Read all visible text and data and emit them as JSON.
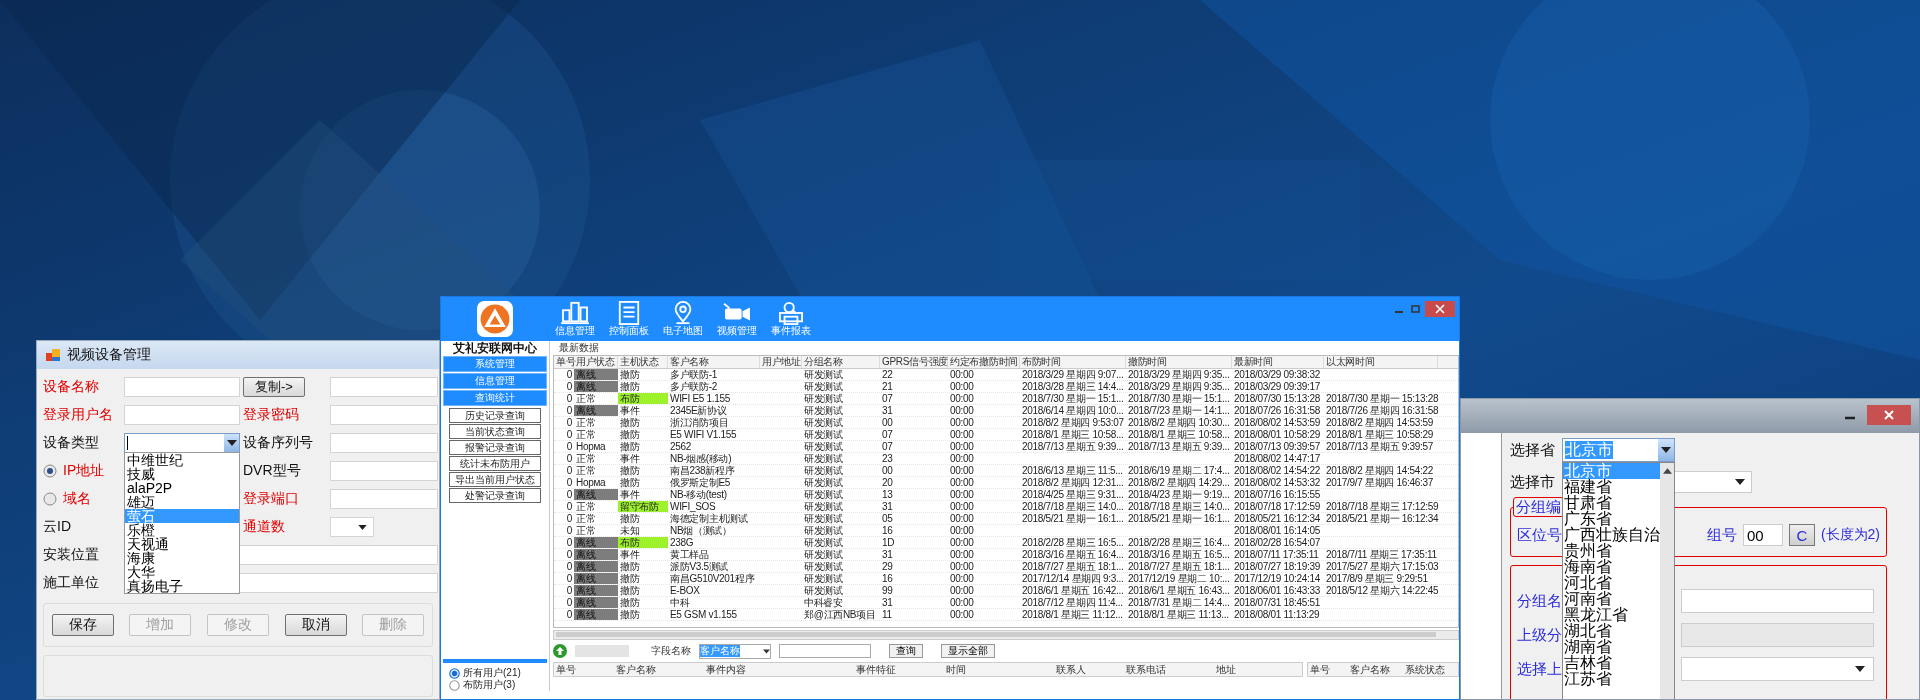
{
  "device_window": {
    "title": "视频设备管理",
    "rows": [
      {
        "left": {
          "kind": "label",
          "text": "设备名称",
          "required": true,
          "control": {
            "kind": "input"
          }
        },
        "right": {
          "kind": "button",
          "text": "复制->",
          "control": {
            "kind": "input"
          }
        }
      },
      {
        "left": {
          "kind": "label",
          "text": "登录用户名",
          "required": true,
          "control": {
            "kind": "input"
          }
        },
        "right": {
          "kind": "label",
          "text": "登录密码",
          "required": true,
          "control": {
            "kind": "input"
          }
        }
      },
      {
        "left": {
          "kind": "label",
          "text": "设备类型",
          "required": false,
          "control": {
            "kind": "combo"
          }
        },
        "right": {
          "kind": "label",
          "text": "设备序列号",
          "required": false,
          "control": {
            "kind": "input"
          }
        }
      },
      {
        "left": {
          "kind": "radio",
          "text": "IP地址",
          "required": true,
          "selected": true
        },
        "right": {
          "kind": "label",
          "text": "DVR型号",
          "required": false,
          "control": {
            "kind": "input"
          }
        }
      },
      {
        "left": {
          "kind": "radio",
          "text": "域名",
          "required": true,
          "selected": false
        },
        "right": {
          "kind": "label",
          "text": "登录端口",
          "required": true,
          "control": {
            "kind": "input"
          }
        }
      },
      {
        "left": {
          "kind": "label",
          "text": "云ID",
          "required": false
        },
        "right": {
          "kind": "label",
          "text": "通道数",
          "required": true,
          "control": {
            "kind": "select"
          }
        }
      },
      {
        "left": {
          "kind": "label",
          "text": "安装位置",
          "required": false,
          "control": {
            "kind": "wide"
          }
        }
      },
      {
        "left": {
          "kind": "label",
          "text": "施工单位",
          "required": false,
          "control": {
            "kind": "wide"
          }
        }
      }
    ],
    "device_types": [
      {
        "text": "中维世纪",
        "selected": false
      },
      {
        "text": "技威",
        "selected": false
      },
      {
        "text": "alaP2P",
        "selected": false
      },
      {
        "text": "雄迈",
        "selected": false
      },
      {
        "text": "萤石",
        "selected": true
      },
      {
        "text": "乐橙",
        "selected": false
      },
      {
        "text": "天视通",
        "selected": false
      },
      {
        "text": "海康",
        "selected": false
      },
      {
        "text": "大华",
        "selected": false
      },
      {
        "text": "真扬电子",
        "selected": false
      }
    ],
    "buttons": [
      {
        "text": "保存",
        "disabled": false
      },
      {
        "text": "增加",
        "disabled": true
      },
      {
        "text": "修改",
        "disabled": true
      },
      {
        "text": "取消",
        "disabled": false
      },
      {
        "text": "删除",
        "disabled": true
      }
    ]
  },
  "monitor_window": {
    "brand": "艾礼安联网中心",
    "toolbar": [
      {
        "label": "信息管理",
        "kind": "buildings"
      },
      {
        "label": "控制面板",
        "kind": "list"
      },
      {
        "label": "电子地图",
        "kind": "pin"
      },
      {
        "label": "视频管理",
        "kind": "camera"
      },
      {
        "label": "事件报表",
        "kind": "printer"
      }
    ],
    "menu": [
      "系统管理",
      "信息管理",
      "查询统计"
    ],
    "submenu": [
      "历史记录查询",
      "当前状态查询",
      "报警记录查询",
      "统计未布防用户",
      "导出当前用户状态",
      "处警记录查询"
    ],
    "tab": "最新数据",
    "columns": [
      "单号",
      "用户状态",
      "主机状态",
      "客户名称",
      "用户地址",
      "分组名称",
      "GPRS信号强度",
      "约定布撤防时间",
      "布防时间",
      "撤防时间",
      "最新时间",
      "以太网时间"
    ],
    "rows": [
      {
        "no": "0",
        "user_state": "离线",
        "offline": true,
        "host_state": "撤防",
        "armed": false,
        "customer": "多户联防-1",
        "group": "研发测试",
        "gprs": "22",
        "schedule": "00:00",
        "arm_time": "2018/3/29 星期四 9:07...",
        "disarm_time": "2018/3/29 星期四 9:35...",
        "latest": "2018/03/29 09:38:32"
      },
      {
        "no": "0",
        "user_state": "离线",
        "offline": true,
        "host_state": "撤防",
        "armed": false,
        "customer": "多户联防-2",
        "group": "研发测试",
        "gprs": "21",
        "schedule": "00:00",
        "arm_time": "2018/3/28 星期三 14:4...",
        "disarm_time": "2018/3/29 星期四 9:35...",
        "latest": "2018/03/29 09:39:17"
      },
      {
        "no": "0",
        "user_state": "正常",
        "offline": false,
        "host_state": "布防",
        "armed": true,
        "customer": "WIFI E5 1.155",
        "group": "研发测试",
        "gprs": "07",
        "schedule": "00:00",
        "arm_time": "2018/7/30 星期一 15:1...",
        "disarm_time": "2018/7/30 星期一 15:1...",
        "latest": "2018/07/30 15:13:28",
        "ethernet_time": "2018/7/30 星期一 15:13:28"
      },
      {
        "no": "0",
        "user_state": "离线",
        "offline": true,
        "host_state": "事件",
        "armed": false,
        "customer": "2345E新协议",
        "group": "研发测试",
        "gprs": "31",
        "schedule": "00:00",
        "arm_time": "2018/6/14 星期四 10:0...",
        "disarm_time": "2018/7/23 星期一 14:1...",
        "latest": "2018/07/26 16:31:58",
        "ethernet_time": "2018/7/26 星期四 16:31:58"
      },
      {
        "no": "0",
        "user_state": "正常",
        "offline": false,
        "host_state": "撤防",
        "armed": false,
        "customer": "浙江消防项目",
        "group": "研发测试",
        "gprs": "00",
        "schedule": "00:00",
        "arm_time": "2018/8/2 星期四 9:53:07",
        "disarm_time": "2018/8/2 星期四 10:30...",
        "latest": "2018/08/02 14:53:59",
        "ethernet_time": "2018/8/2 星期四 14:53:59"
      },
      {
        "no": "0",
        "user_state": "正常",
        "offline": false,
        "host_state": "撤防",
        "armed": false,
        "customer": "E5 WIFI V1.155",
        "group": "研发测试",
        "gprs": "07",
        "schedule": "00:00",
        "arm_time": "2018/8/1 星期三 10:58...",
        "disarm_time": "2018/8/1 星期三 10:58...",
        "latest": "2018/08/01 10:58:29",
        "ethernet_time": "2018/8/1 星期三 10:58:29"
      },
      {
        "no": "0",
        "user_state": "Норма",
        "offline": false,
        "host_state": "撤防",
        "armed": false,
        "customer": "2562",
        "group": "研发测试",
        "gprs": "07",
        "schedule": "00:00",
        "arm_time": "2018/7/13 星期五 9:39...",
        "disarm_time": "2018/7/13 星期五 9:39...",
        "latest": "2018/07/13 09:39:57",
        "ethernet_time": "2018/7/13 星期五 9:39:57"
      },
      {
        "no": "0",
        "user_state": "正常",
        "offline": false,
        "host_state": "事件",
        "armed": false,
        "customer": "NB-烟感(移动)",
        "group": "研发测试",
        "gprs": "23",
        "schedule": "00:00",
        "latest": "2018/08/02 14:47:17"
      },
      {
        "no": "0",
        "user_state": "正常",
        "offline": false,
        "host_state": "撤防",
        "armed": false,
        "customer": "南昌238新程序",
        "group": "研发测试",
        "gprs": "00",
        "schedule": "00:00",
        "arm_time": "2018/6/13 星期三 11:5...",
        "disarm_time": "2018/6/19 星期二 17:4...",
        "latest": "2018/08/02 14:54:22",
        "ethernet_time": "2018/8/2 星期四 14:54:22"
      },
      {
        "no": "0",
        "user_state": "Норма",
        "offline": false,
        "host_state": "撤防",
        "armed": false,
        "customer": "俄罗斯定制E5",
        "group": "研发测试",
        "gprs": "20",
        "schedule": "00:00",
        "arm_time": "2018/8/2 星期四 12:31...",
        "disarm_time": "2018/8/2 星期四 14:29...",
        "latest": "2018/08/02 14:53:32",
        "ethernet_time": "2017/9/7 星期四 16:46:37"
      },
      {
        "no": "0",
        "user_state": "离线",
        "offline": true,
        "host_state": "事件",
        "armed": false,
        "customer": "NB-移动(test)",
        "group": "研发测试",
        "gprs": "13",
        "schedule": "00:00",
        "arm_time": "2018/4/25 星期三 9:31...",
        "disarm_time": "2018/4/23 星期一 9:19...",
        "latest": "2018/07/16 16:15:55"
      },
      {
        "no": "0",
        "user_state": "正常",
        "offline": false,
        "host_state": "留守布防",
        "armed": true,
        "customer": "WIFI_SOS",
        "group": "研发测试",
        "gprs": "31",
        "schedule": "00:00",
        "arm_time": "2018/7/18 星期三 14:0...",
        "disarm_time": "2018/7/18 星期三 14:0...",
        "latest": "2018/07/18 17:12:59",
        "ethernet_time": "2018/7/18 星期三 17:12:59"
      },
      {
        "no": "0",
        "user_state": "正常",
        "offline": false,
        "host_state": "撤防",
        "armed": false,
        "customer": "海德定制主机测试",
        "group": "研发测试",
        "gprs": "05",
        "schedule": "00:00",
        "arm_time": "2018/5/21 星期一 16:1...",
        "disarm_time": "2018/5/21 星期一 16:1...",
        "latest": "2018/05/21 16:12:34",
        "ethernet_time": "2018/5/21 星期一 16:12:34"
      },
      {
        "no": "0",
        "user_state": "正常",
        "offline": false,
        "host_state": "未知",
        "armed": false,
        "customer": "NB烟（测试）",
        "group": "研发测试",
        "gprs": "16",
        "schedule": "00:00",
        "latest": "2018/08/01 16:14:05"
      },
      {
        "no": "0",
        "user_state": "离线",
        "offline": true,
        "host_state": "布防",
        "armed": true,
        "customer": "238G",
        "group": "研发测试",
        "gprs": "1D",
        "schedule": "00:00",
        "arm_time": "2018/2/28 星期三 16:5...",
        "disarm_time": "2018/2/28 星期三 16:4...",
        "latest": "2018/02/28 16:54:07"
      },
      {
        "no": "0",
        "user_state": "离线",
        "offline": true,
        "host_state": "事件",
        "armed": false,
        "customer": "黄工样品",
        "group": "研发测试",
        "gprs": "31",
        "schedule": "00:00",
        "arm_time": "2018/3/16 星期五 16:4...",
        "disarm_time": "2018/3/16 星期五 16:5...",
        "latest": "2018/07/11 17:35:11",
        "ethernet_time": "2018/7/11 星期三 17:35:11"
      },
      {
        "no": "0",
        "user_state": "离线",
        "offline": true,
        "host_state": "撤防",
        "armed": false,
        "customer": "派防V3.5测试",
        "group": "研发测试",
        "gprs": "29",
        "schedule": "00:00",
        "arm_time": "2018/7/27 星期五 18:1...",
        "disarm_time": "2018/7/27 星期五 18:1...",
        "latest": "2018/07/27 18:19:39",
        "ethernet_time": "2017/5/27 星期六 17:15:03"
      },
      {
        "no": "0",
        "user_state": "离线",
        "offline": true,
        "host_state": "撤防",
        "armed": false,
        "customer": "南昌G510V201程序",
        "group": "研发测试",
        "gprs": "16",
        "schedule": "00:00",
        "arm_time": "2017/12/14 星期四 9:3...",
        "disarm_time": "2017/12/19 星期二 10:...",
        "latest": "2017/12/19 10:24:14",
        "ethernet_time": "2017/8/9 星期三 9:29:51"
      },
      {
        "no": "0",
        "user_state": "离线",
        "offline": true,
        "host_state": "撤防",
        "armed": false,
        "customer": "E-BOX",
        "group": "研发测试",
        "gprs": "99",
        "schedule": "00:00",
        "arm_time": "2018/6/1 星期五 16:42...",
        "disarm_time": "2018/6/1 星期五 16:43...",
        "latest": "2018/06/01 16:43:33",
        "ethernet_time": "2018/5/12 星期六 14:22:45"
      },
      {
        "no": "0",
        "user_state": "离线",
        "offline": true,
        "host_state": "撤防",
        "armed": false,
        "customer": "中科",
        "group": "中科睿安",
        "gprs": "31",
        "schedule": "00:00",
        "arm_time": "2018/7/12 星期四 11:4...",
        "disarm_time": "2018/7/31 星期二 14:4...",
        "latest": "2018/07/31 18:45:51"
      },
      {
        "no": "0",
        "user_state": "离线",
        "offline": true,
        "host_state": "撤防",
        "armed": false,
        "customer": "E5 GSM v1.155",
        "group": "郑@江西NB项目",
        "gprs": "11",
        "schedule": "00:00",
        "arm_time": "2018/8/1 星期三 11:12...",
        "disarm_time": "2018/8/1 星期三 11:13...",
        "latest": "2018/08/01 11:13:29"
      }
    ],
    "search": {
      "field_label": "字段名称",
      "field_value": "客户名称",
      "query": "查询",
      "show_all": "显示全部"
    },
    "filters": [
      {
        "label": "所有用户(21)",
        "selected": true
      },
      {
        "label": "布防用户(3)",
        "selected": false
      }
    ],
    "event_columns": [
      "单号",
      "客户名称",
      "事件内容",
      "事件特征",
      "时间",
      "联系人",
      "联系电话",
      "地址"
    ],
    "status_columns": [
      "单号",
      "客户名称",
      "系统状态"
    ]
  },
  "group_window": {
    "province_label": "选择省",
    "province": "北京市",
    "provinces": [
      {
        "text": "北京市",
        "selected": true
      },
      {
        "text": "福建省",
        "selected": false
      },
      {
        "text": "甘肃省",
        "selected": false
      },
      {
        "text": "广东省",
        "selected": false
      },
      {
        "text": "广西壮族自治",
        "selected": false
      },
      {
        "text": "贵州省",
        "selected": false
      },
      {
        "text": "海南省",
        "selected": false
      },
      {
        "text": "河北省",
        "selected": false
      },
      {
        "text": "河南省",
        "selected": false
      },
      {
        "text": "黑龙江省",
        "selected": false
      },
      {
        "text": "湖北省",
        "selected": false
      },
      {
        "text": "湖南省",
        "selected": false
      },
      {
        "text": "吉林省",
        "selected": false
      },
      {
        "text": "江苏省",
        "selected": false
      }
    ],
    "city_label": "选择市",
    "group_legend": "分组编",
    "zone_label": "区位号",
    "group_no_label": "组号",
    "group_no": "00",
    "clear_button": "C",
    "length_hint": "(长度为2)",
    "name_label": "分组名",
    "parent_label": "上级分",
    "select_parent_label": "选择上"
  }
}
